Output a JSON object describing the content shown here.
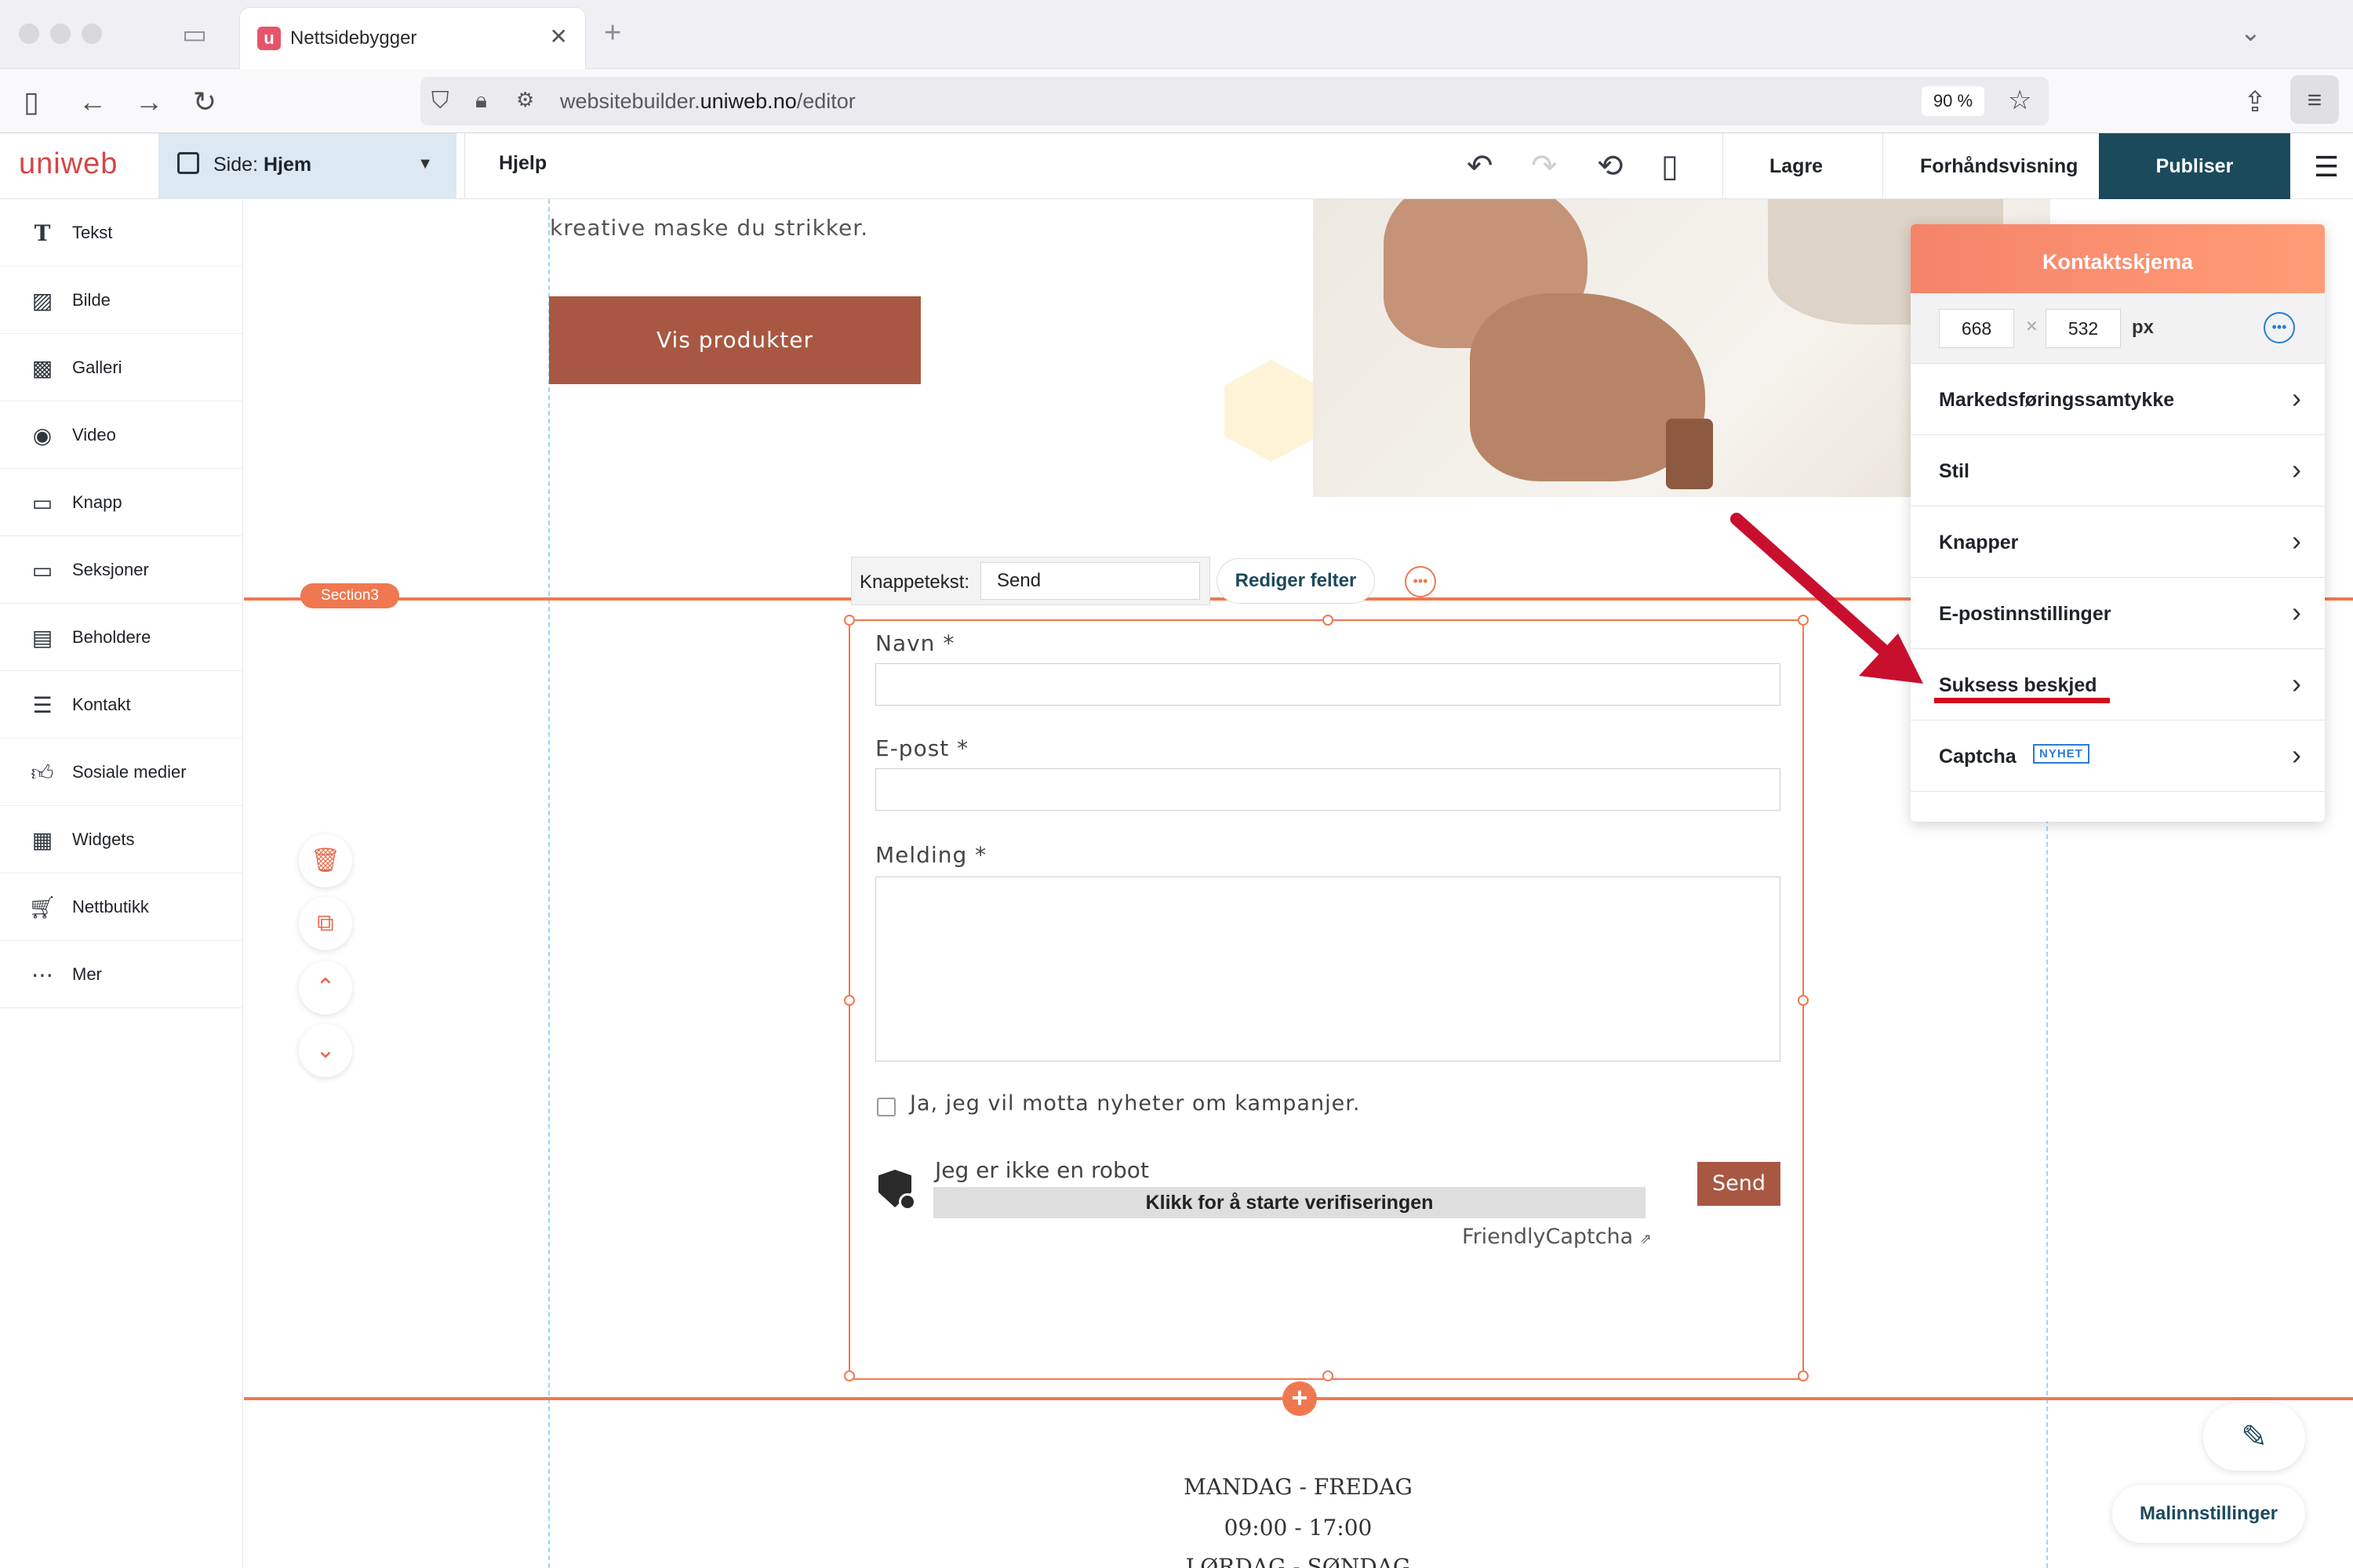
{
  "browser": {
    "tab_title": "Nettsidebygger",
    "tab_favicon": "u",
    "url_prefix": "websitebuilder.",
    "url_domain": "uniweb.no",
    "url_path": "/editor",
    "zoom": "90 %"
  },
  "app": {
    "logo": "uniweb",
    "page_selector": {
      "prefix": "Side:",
      "value": "Hjem"
    },
    "help": "Hjelp",
    "save": "Lagre",
    "preview": "Forhåndsvisning",
    "publish": "Publiser",
    "colors": {
      "publish_bg": "#1b4a5c",
      "accent": "#f07850",
      "button_brown": "#a85842",
      "page_selector_bg": "#dce8f2"
    }
  },
  "sidebar": {
    "items": [
      {
        "label": "Tekst",
        "icon": "text-icon"
      },
      {
        "label": "Bilde",
        "icon": "image-icon"
      },
      {
        "label": "Galleri",
        "icon": "gallery-icon"
      },
      {
        "label": "Video",
        "icon": "video-icon"
      },
      {
        "label": "Knapp",
        "icon": "button-icon"
      },
      {
        "label": "Seksjoner",
        "icon": "section-icon"
      },
      {
        "label": "Beholdere",
        "icon": "container-icon"
      },
      {
        "label": "Kontakt",
        "icon": "contact-icon"
      },
      {
        "label": "Sosiale medier",
        "icon": "thumbs-up-icon"
      },
      {
        "label": "Widgets",
        "icon": "widgets-icon"
      },
      {
        "label": "Nettbutikk",
        "icon": "cart-icon"
      },
      {
        "label": "Mer",
        "icon": "more-icon"
      }
    ]
  },
  "canvas": {
    "hero_text": "kreative maske du strikker.",
    "hero_button": "Vis produkter",
    "section_tag": "Section3",
    "button_text_label": "Knappetekst:",
    "button_text_value": "Send",
    "edit_fields": "Rediger felter",
    "form": {
      "name_label": "Navn *",
      "email_label": "E-post *",
      "message_label": "Melding *",
      "newsletter_label": "Ja, jeg vil motta nyheter om kampanjer.",
      "robot_label": "Jeg er ikke en robot",
      "verify_button": "Klikk for å starte verifiseringen",
      "captcha_brand": "FriendlyCaptcha",
      "send_button": "Send"
    },
    "footer": {
      "line1": "MANDAG - FREDAG",
      "line2": "09:00 - 17:00",
      "line3": "LØRDAG - SØNDAG"
    },
    "template_settings": "Malinnstillinger"
  },
  "panel": {
    "title": "Kontaktskjema",
    "width": "668",
    "height": "532",
    "unit": "px",
    "items": [
      {
        "label": "Markedsføringssamtykke"
      },
      {
        "label": "Stil"
      },
      {
        "label": "Knapper"
      },
      {
        "label": "E-postinnstillinger"
      },
      {
        "label": "Suksess beskjed"
      },
      {
        "label": "Captcha",
        "badge": "NYHET"
      }
    ]
  }
}
